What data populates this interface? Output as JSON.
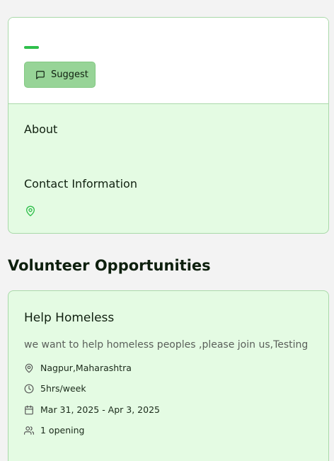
{
  "organization": {
    "suggest_label": "Suggest",
    "about_title": "About",
    "contact_title": "Contact Information"
  },
  "section": {
    "heading": "Volunteer Opportunities"
  },
  "opportunity": {
    "title": "Help Homeless",
    "description": "we want to help homeless peoples ,please join us,Testing",
    "location": "Nagpur,Maharashtra",
    "commitment": "5hrs/week",
    "dates": "Mar 31, 2025 - Apr 3, 2025",
    "openings": "1 opening"
  },
  "icons": {
    "suggest": "message-square-icon",
    "contact_location": "map-pin-icon",
    "location": "map-pin-icon",
    "time": "clock-icon",
    "calendar": "calendar-icon",
    "users": "users-icon"
  },
  "colors": {
    "accent": "#2fbf4b",
    "card_bg": "#e4fbe3",
    "button_bg": "#97d497",
    "border": "#a9d9a9"
  }
}
